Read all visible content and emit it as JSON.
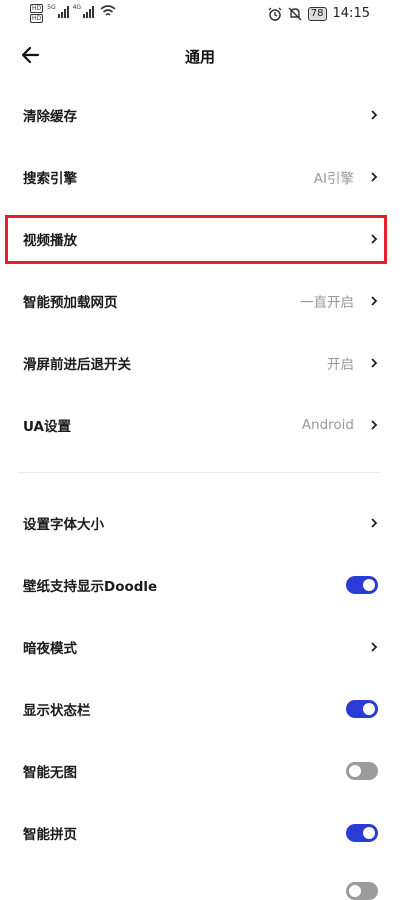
{
  "status_bar": {
    "hd1": "HD",
    "hd2": "HD",
    "net1": "5G",
    "net2": "4G",
    "battery": "78",
    "time": "14:15"
  },
  "header": {
    "title": "通用"
  },
  "rows_top": [
    {
      "label": "清除缓存",
      "value": ""
    },
    {
      "label": "搜索引擎",
      "value": "AI引擎"
    },
    {
      "label": "视频播放",
      "value": ""
    },
    {
      "label": "智能预加载网页",
      "value": "一直开启"
    },
    {
      "label": "滑屏前进后退开关",
      "value": "开启"
    },
    {
      "label": "UA设置",
      "value": "Android"
    }
  ],
  "rows_bottom": [
    {
      "label": "设置字体大小",
      "control": "chevron"
    },
    {
      "label": "壁纸支持显示Doodle",
      "control": "toggle",
      "state": "on"
    },
    {
      "label": "暗夜模式",
      "control": "chevron"
    },
    {
      "label": "显示状态栏",
      "control": "toggle",
      "state": "on"
    },
    {
      "label": "智能无图",
      "control": "toggle",
      "state": "off"
    },
    {
      "label": "智能拼页",
      "control": "toggle",
      "state": "on"
    }
  ],
  "colors": {
    "accent": "#2a3bd6",
    "highlight": "#e0202a",
    "toggle_off": "#9b9b9b"
  }
}
